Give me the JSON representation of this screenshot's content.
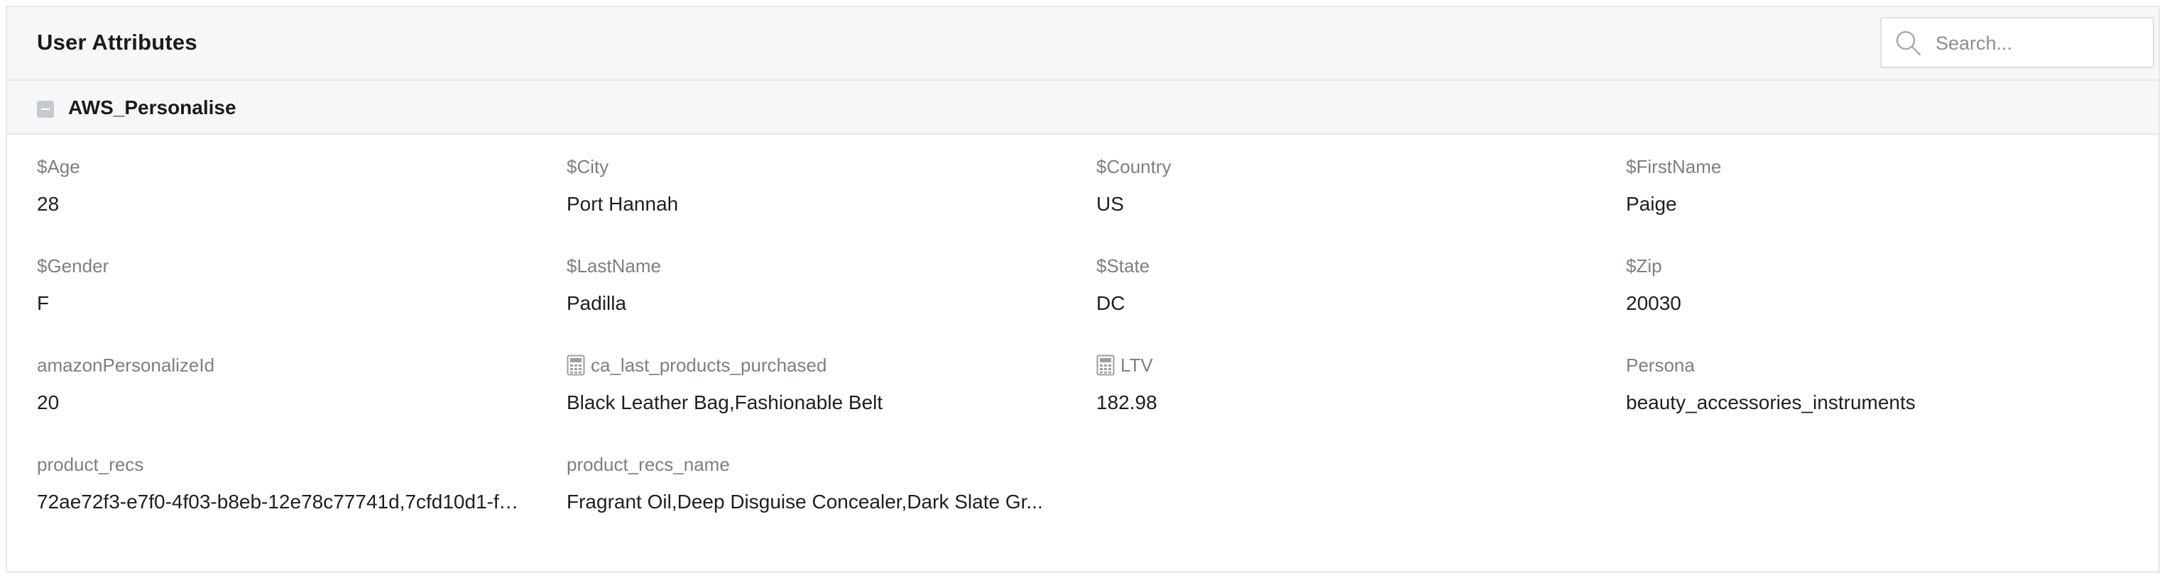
{
  "header": {
    "title": "User Attributes",
    "search_placeholder": "Search..."
  },
  "section": {
    "title": "AWS_Personalise",
    "expanded": true
  },
  "colors": {
    "header_bg": "#f6f7f8",
    "border": "#e5e7ea",
    "label": "#7b8087",
    "value": "#1f1f1f"
  },
  "attributes": [
    {
      "label": "$Age",
      "value": "28",
      "icon": ""
    },
    {
      "label": "$City",
      "value": "Port Hannah",
      "icon": ""
    },
    {
      "label": "$Country",
      "value": "US",
      "icon": ""
    },
    {
      "label": "$FirstName",
      "value": "Paige",
      "icon": ""
    },
    {
      "label": "$Gender",
      "value": "F",
      "icon": ""
    },
    {
      "label": "$LastName",
      "value": "Padilla",
      "icon": ""
    },
    {
      "label": "$State",
      "value": "DC",
      "icon": ""
    },
    {
      "label": "$Zip",
      "value": "20030",
      "icon": ""
    },
    {
      "label": "amazonPersonalizeId",
      "value": "20",
      "icon": ""
    },
    {
      "label": "ca_last_products_purchased",
      "value": "Black Leather Bag,Fashionable Belt",
      "icon": "calculator-icon"
    },
    {
      "label": "LTV",
      "value": "182.98",
      "icon": "calculator-icon"
    },
    {
      "label": "Persona",
      "value": "beauty_accessories_instruments",
      "icon": ""
    },
    {
      "label": "product_recs",
      "value": "72ae72f3-e7f0-4f03-b8eb-12e78c77741d,7cfd10d1-ff...",
      "icon": ""
    },
    {
      "label": "product_recs_name",
      "value": "Fragrant Oil,Deep Disguise Concealer,Dark Slate Gr...",
      "icon": ""
    }
  ]
}
